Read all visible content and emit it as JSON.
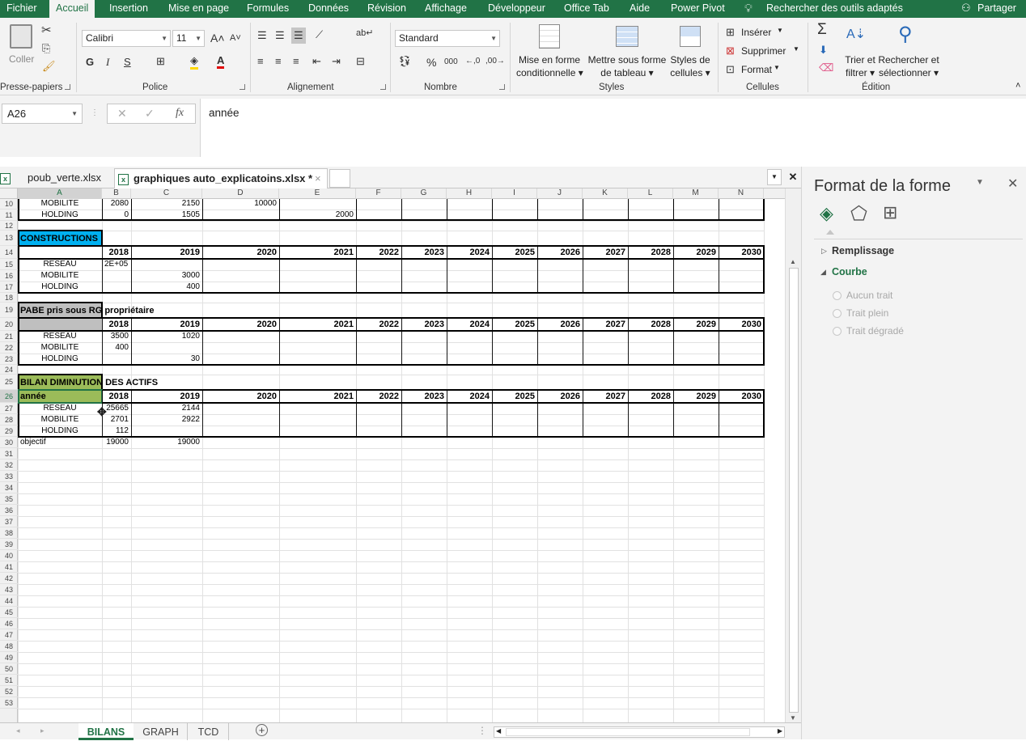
{
  "menu": {
    "tabs": [
      "Fichier",
      "Accueil",
      "Insertion",
      "Mise en page",
      "Formules",
      "Données",
      "Révision",
      "Affichage",
      "Développeur",
      "Office Tab",
      "Aide",
      "Power Pivot"
    ],
    "search": "Rechercher des outils adaptés",
    "share": "Partager"
  },
  "ribbon": {
    "clipboard": {
      "paste": "Coller",
      "label": "Presse-papiers"
    },
    "font": {
      "name": "Calibri",
      "size": "11",
      "bold": "G",
      "italic": "I",
      "underline": "S",
      "label": "Police"
    },
    "alignment": {
      "label": "Alignement"
    },
    "number": {
      "format": "Standard",
      "percent": "%",
      "thousands": "000",
      "dec_inc": "←,0",
      "dec_dec": ",00→",
      "label": "Nombre"
    },
    "styles": {
      "cond_line1": "Mise en forme",
      "cond_line2": "conditionnelle",
      "table_line1": "Mettre sous forme",
      "table_line2": "de tableau",
      "cell_line1": "Styles de",
      "cell_line2": "cellules",
      "label": "Styles"
    },
    "cells": {
      "insert": "Insérer",
      "delete": "Supprimer",
      "format": "Format",
      "label": "Cellules"
    },
    "editing": {
      "sort_line1": "Trier et",
      "sort_line2": "filtrer",
      "find_line1": "Rechercher et",
      "find_line2": "sélectionner",
      "label": "Édition"
    }
  },
  "formula_bar": {
    "name_box": "A26",
    "fx": "fx",
    "content": "année"
  },
  "doc_tabs": [
    {
      "name": "poub_verte.xlsx",
      "active": false
    },
    {
      "name": "graphiques auto_explicatoins.xlsx *",
      "active": true
    }
  ],
  "columns": [
    "A",
    "B",
    "C",
    "D",
    "E",
    "F",
    "G",
    "H",
    "I",
    "J",
    "K",
    "L",
    "M",
    "N"
  ],
  "rows": [
    "10",
    "11",
    "12",
    "13",
    "14",
    "15",
    "16",
    "17",
    "18",
    "19",
    "20",
    "21",
    "22",
    "23",
    "24",
    "25",
    "26",
    "27",
    "28",
    "29",
    "30",
    "31",
    "32",
    "33",
    "34",
    "35",
    "36",
    "37",
    "38",
    "39",
    "40",
    "41",
    "42",
    "43",
    "44",
    "45",
    "46",
    "47",
    "48",
    "49",
    "50",
    "51",
    "52",
    "53"
  ],
  "cells": [
    {
      "r": 0,
      "c": 0,
      "v": "MOBILITE",
      "a": "c"
    },
    {
      "r": 0,
      "c": 1,
      "v": "2080",
      "a": "r"
    },
    {
      "r": 0,
      "c": 2,
      "v": "2150",
      "a": "r"
    },
    {
      "r": 0,
      "c": 3,
      "v": "10000",
      "a": "r"
    },
    {
      "r": 1,
      "c": 0,
      "v": "HOLDING",
      "a": "c"
    },
    {
      "r": 1,
      "c": 1,
      "v": "0",
      "a": "r"
    },
    {
      "r": 1,
      "c": 2,
      "v": "1505",
      "a": "r"
    },
    {
      "r": 1,
      "c": 4,
      "v": "2000",
      "a": "r"
    },
    {
      "r": 3,
      "c": 0,
      "v": "CONSTRUCTIONS",
      "a": "l",
      "b": true
    },
    {
      "r": 4,
      "c": 1,
      "v": "2018",
      "a": "r",
      "b": true
    },
    {
      "r": 4,
      "c": 2,
      "v": "2019",
      "a": "r",
      "b": true
    },
    {
      "r": 4,
      "c": 3,
      "v": "2020",
      "a": "r",
      "b": true
    },
    {
      "r": 4,
      "c": 4,
      "v": "2021",
      "a": "r",
      "b": true
    },
    {
      "r": 4,
      "c": 5,
      "v": "2022",
      "a": "r",
      "b": true
    },
    {
      "r": 4,
      "c": 6,
      "v": "2023",
      "a": "r",
      "b": true
    },
    {
      "r": 4,
      "c": 7,
      "v": "2024",
      "a": "r",
      "b": true
    },
    {
      "r": 4,
      "c": 8,
      "v": "2025",
      "a": "r",
      "b": true
    },
    {
      "r": 4,
      "c": 9,
      "v": "2026",
      "a": "r",
      "b": true
    },
    {
      "r": 4,
      "c": 10,
      "v": "2027",
      "a": "r",
      "b": true
    },
    {
      "r": 4,
      "c": 11,
      "v": "2028",
      "a": "r",
      "b": true
    },
    {
      "r": 4,
      "c": 12,
      "v": "2029",
      "a": "r",
      "b": true
    },
    {
      "r": 4,
      "c": 13,
      "v": "2030",
      "a": "r",
      "b": true
    },
    {
      "r": 5,
      "c": 0,
      "v": "RESEAU",
      "a": "c"
    },
    {
      "r": 5,
      "c": 1,
      "v": "2E+05",
      "a": "l"
    },
    {
      "r": 6,
      "c": 0,
      "v": "MOBILITE",
      "a": "c"
    },
    {
      "r": 6,
      "c": 2,
      "v": "3000",
      "a": "r"
    },
    {
      "r": 7,
      "c": 0,
      "v": "HOLDING",
      "a": "c"
    },
    {
      "r": 7,
      "c": 2,
      "v": "400",
      "a": "r"
    },
    {
      "r": 9,
      "c": 0,
      "v": "PABE pris sous RG propriétaire",
      "a": "l",
      "b": true
    },
    {
      "r": 10,
      "c": 1,
      "v": "2018",
      "a": "r",
      "b": true
    },
    {
      "r": 10,
      "c": 2,
      "v": "2019",
      "a": "r",
      "b": true
    },
    {
      "r": 10,
      "c": 3,
      "v": "2020",
      "a": "r",
      "b": true
    },
    {
      "r": 10,
      "c": 4,
      "v": "2021",
      "a": "r",
      "b": true
    },
    {
      "r": 10,
      "c": 5,
      "v": "2022",
      "a": "r",
      "b": true
    },
    {
      "r": 10,
      "c": 6,
      "v": "2023",
      "a": "r",
      "b": true
    },
    {
      "r": 10,
      "c": 7,
      "v": "2024",
      "a": "r",
      "b": true
    },
    {
      "r": 10,
      "c": 8,
      "v": "2025",
      "a": "r",
      "b": true
    },
    {
      "r": 10,
      "c": 9,
      "v": "2026",
      "a": "r",
      "b": true
    },
    {
      "r": 10,
      "c": 10,
      "v": "2027",
      "a": "r",
      "b": true
    },
    {
      "r": 10,
      "c": 11,
      "v": "2028",
      "a": "r",
      "b": true
    },
    {
      "r": 10,
      "c": 12,
      "v": "2029",
      "a": "r",
      "b": true
    },
    {
      "r": 10,
      "c": 13,
      "v": "2030",
      "a": "r",
      "b": true
    },
    {
      "r": 11,
      "c": 0,
      "v": "RESEAU",
      "a": "c"
    },
    {
      "r": 11,
      "c": 1,
      "v": "3500",
      "a": "r"
    },
    {
      "r": 11,
      "c": 2,
      "v": "1020",
      "a": "r"
    },
    {
      "r": 12,
      "c": 0,
      "v": "MOBILITE",
      "a": "c"
    },
    {
      "r": 12,
      "c": 1,
      "v": "400",
      "a": "r"
    },
    {
      "r": 13,
      "c": 0,
      "v": "HOLDING",
      "a": "c"
    },
    {
      "r": 13,
      "c": 2,
      "v": "30",
      "a": "r"
    },
    {
      "r": 15,
      "c": 0,
      "v": "BILAN DIMINUTION DES ACTIFS",
      "a": "l",
      "b": true
    },
    {
      "r": 16,
      "c": 0,
      "v": "année",
      "a": "l",
      "b": true
    },
    {
      "r": 16,
      "c": 1,
      "v": "2018",
      "a": "r",
      "b": true
    },
    {
      "r": 16,
      "c": 2,
      "v": "2019",
      "a": "r",
      "b": true
    },
    {
      "r": 16,
      "c": 3,
      "v": "2020",
      "a": "r",
      "b": true
    },
    {
      "r": 16,
      "c": 4,
      "v": "2021",
      "a": "r",
      "b": true
    },
    {
      "r": 16,
      "c": 5,
      "v": "2022",
      "a": "r",
      "b": true
    },
    {
      "r": 16,
      "c": 6,
      "v": "2023",
      "a": "r",
      "b": true
    },
    {
      "r": 16,
      "c": 7,
      "v": "2024",
      "a": "r",
      "b": true
    },
    {
      "r": 16,
      "c": 8,
      "v": "2025",
      "a": "r",
      "b": true
    },
    {
      "r": 16,
      "c": 9,
      "v": "2026",
      "a": "r",
      "b": true
    },
    {
      "r": 16,
      "c": 10,
      "v": "2027",
      "a": "r",
      "b": true
    },
    {
      "r": 16,
      "c": 11,
      "v": "2028",
      "a": "r",
      "b": true
    },
    {
      "r": 16,
      "c": 12,
      "v": "2029",
      "a": "r",
      "b": true
    },
    {
      "r": 16,
      "c": 13,
      "v": "2030",
      "a": "r",
      "b": true
    },
    {
      "r": 17,
      "c": 0,
      "v": "RESEAU",
      "a": "c"
    },
    {
      "r": 17,
      "c": 1,
      "v": "25665",
      "a": "r"
    },
    {
      "r": 17,
      "c": 2,
      "v": "2144",
      "a": "r"
    },
    {
      "r": 18,
      "c": 0,
      "v": "MOBILITE",
      "a": "c"
    },
    {
      "r": 18,
      "c": 1,
      "v": "2701",
      "a": "r"
    },
    {
      "r": 18,
      "c": 2,
      "v": "2922",
      "a": "r"
    },
    {
      "r": 19,
      "c": 0,
      "v": "HOLDING",
      "a": "c"
    },
    {
      "r": 19,
      "c": 1,
      "v": "112",
      "a": "r"
    },
    {
      "r": 20,
      "c": 0,
      "v": "objectif",
      "a": "l"
    },
    {
      "r": 20,
      "c": 1,
      "v": "19000",
      "a": "r"
    },
    {
      "r": 20,
      "c": 2,
      "v": "19000",
      "a": "r"
    }
  ],
  "sheet_tabs": [
    {
      "name": "BILANS",
      "active": true
    },
    {
      "name": "GRAPH",
      "active": false
    },
    {
      "name": "TCD",
      "active": false
    }
  ],
  "pane": {
    "title": "Format de la forme",
    "fill": "Remplissage",
    "line": "Courbe",
    "options": [
      "Aucun trait",
      "Trait plein",
      "Trait dégradé"
    ]
  },
  "colors": {
    "accent": "#217346",
    "blue_header": "#00b0f0",
    "gray_header": "#bfbfbf",
    "green_header": "#9bbb59"
  }
}
